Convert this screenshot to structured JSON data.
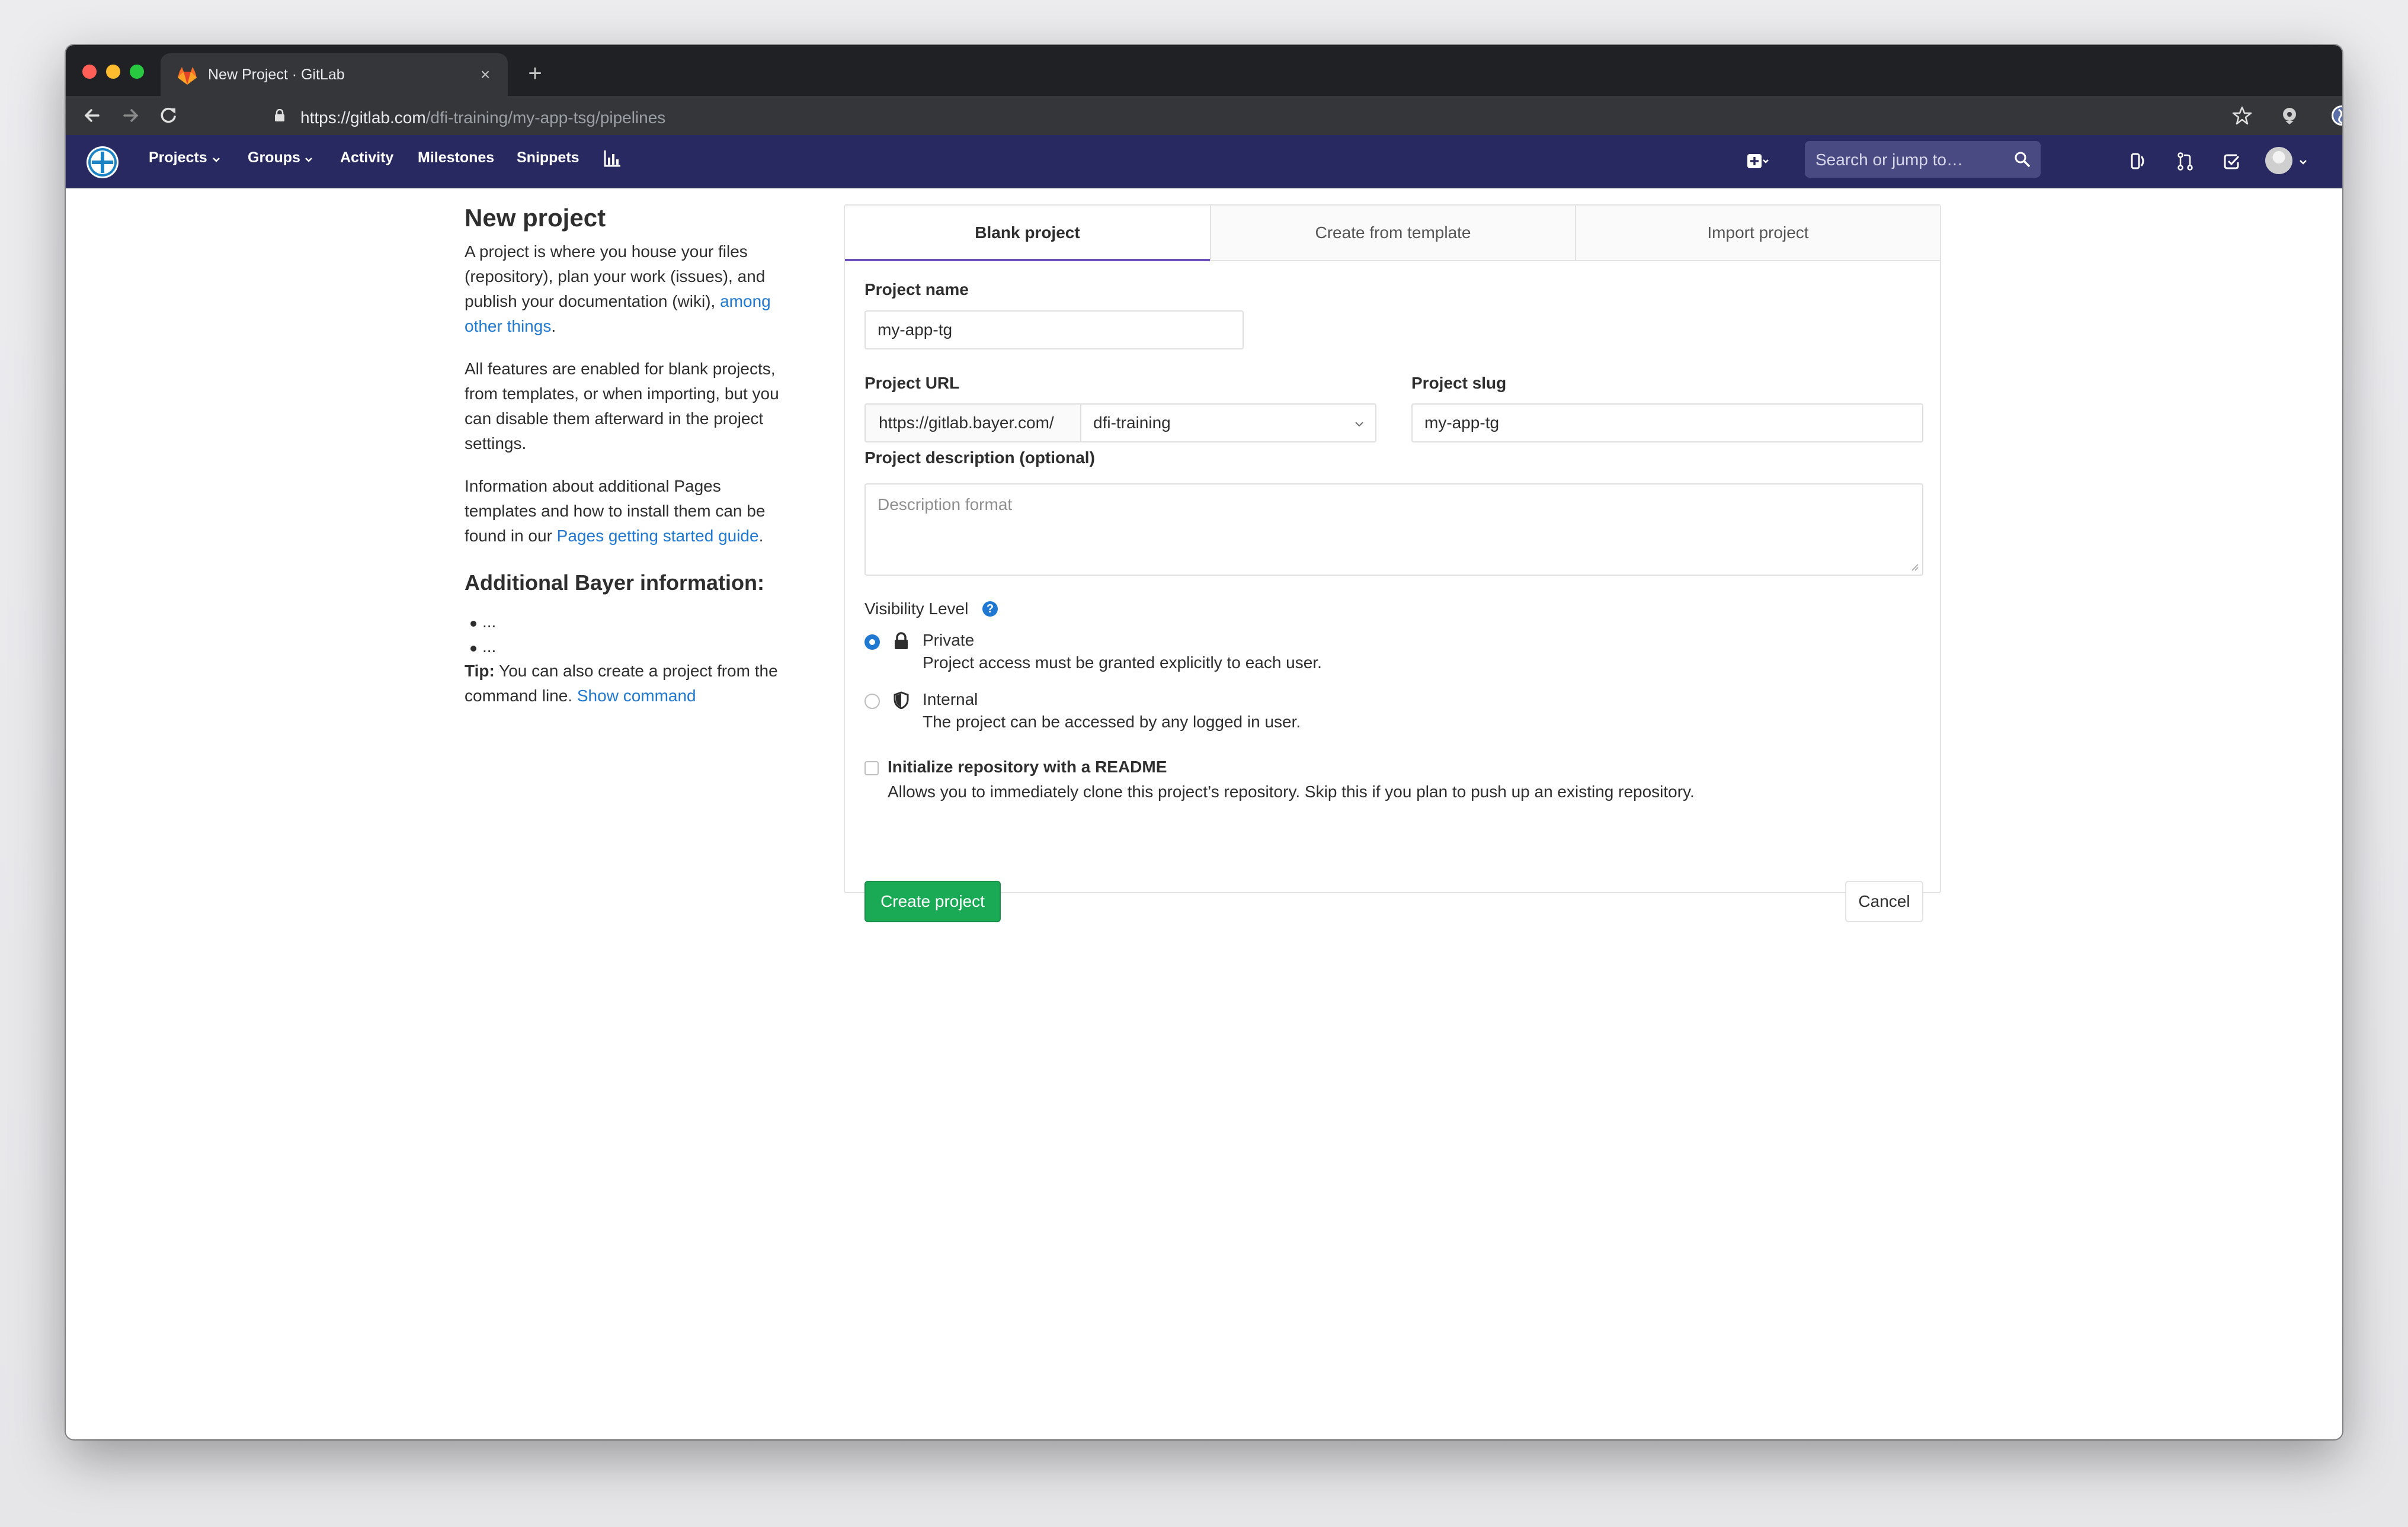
{
  "browser": {
    "tab_title": "New Project · GitLab",
    "tab_close": "×",
    "new_tab": "+",
    "url_host": "https://gitlab.com",
    "url_path": "/dfi-training/my-app-tsg/pipelines"
  },
  "navbar": {
    "items": [
      "Projects",
      "Groups",
      "Activity",
      "Milestones",
      "Snippets"
    ],
    "search_placeholder": "Search or jump to…",
    "brand_color": "#292961"
  },
  "sidebar": {
    "title": "New project",
    "p1_text": "A project is where you house your files (repository), plan your work (issues), and publish your documentation (wiki), ",
    "p1_link": "among other things",
    "p1_end": ".",
    "p2": "All features are enabled for blank projects, from templates, or when importing, but you can disable them afterward in the project settings.",
    "p3_text": "Information about additional Pages templates and how to install them can be found in our ",
    "p3_link": "Pages getting started guide",
    "p3_end": ".",
    "heading": "Additional Bayer information:",
    "bullets": [
      "...",
      "..."
    ],
    "tip_label": "Tip:",
    "tip_text": " You can also create a project from the command line. ",
    "tip_link": "Show command"
  },
  "form": {
    "tabs": [
      "Blank project",
      "Create from template",
      "Import project"
    ],
    "project_name_label": "Project name",
    "project_name_value": "my-app-tg",
    "project_url_label": "Project URL",
    "project_url_prefix": "https://gitlab.bayer.com/",
    "namespace_value": "dfi-training",
    "project_slug_label": "Project slug",
    "project_slug_value": "my-app-tg",
    "description_label": "Project description (optional)",
    "description_placeholder": "Description format",
    "visibility_label": "Visibility Level",
    "help_glyph": "?",
    "visibility_options": [
      {
        "title": "Private",
        "desc": "Project access must be granted explicitly to each user.",
        "checked": true
      },
      {
        "title": "Internal",
        "desc": "The project can be accessed by any logged in user.",
        "checked": false
      }
    ],
    "readme_label": "Initialize repository with a README",
    "readme_desc": "Allows you to immediately clone this project’s repository. Skip this if you plan to push up an existing repository.",
    "create_button": "Create project",
    "cancel_button": "Cancel",
    "accent_color": "#1aaa55",
    "link_color": "#1f78d1"
  }
}
